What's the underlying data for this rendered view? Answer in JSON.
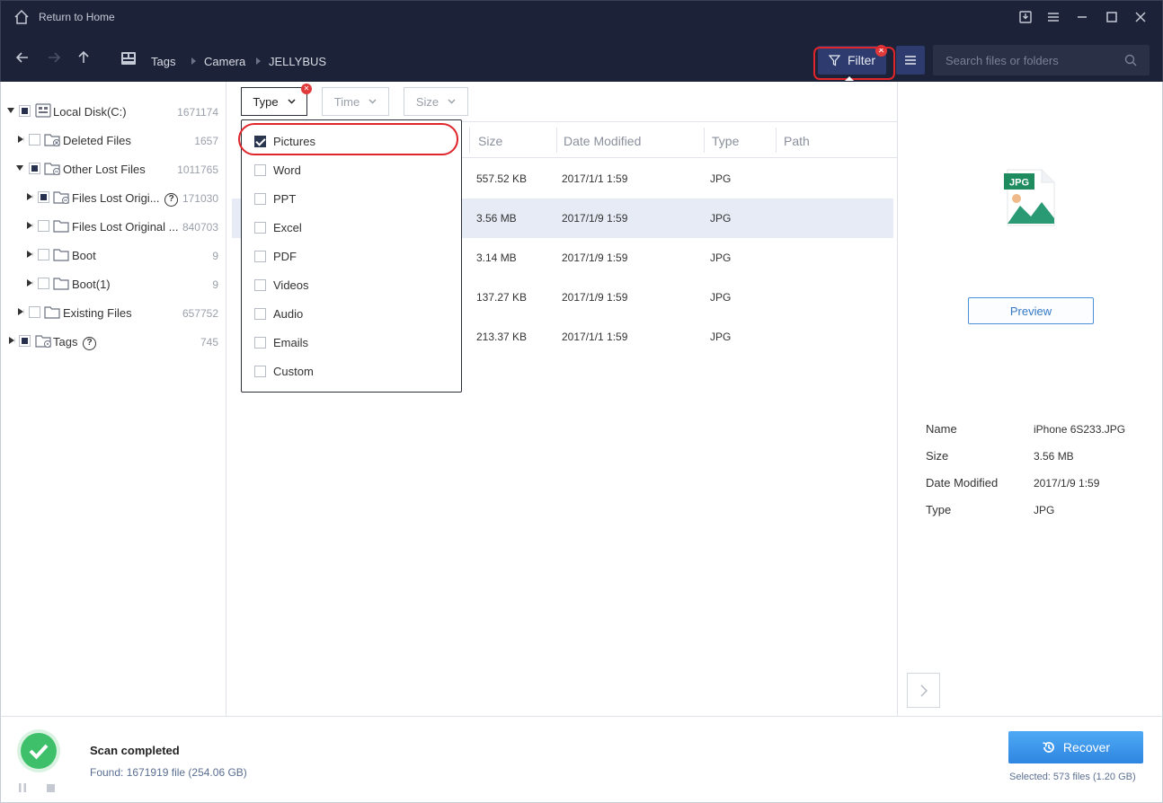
{
  "titlebar": {
    "home_label": "Return to Home"
  },
  "nav": {
    "breadcrumb": [
      "Tags",
      "Camera",
      "JELLYBUS"
    ],
    "filter_label": "Filter",
    "search_placeholder": "Search files or folders"
  },
  "tree": [
    {
      "label": "Local Disk(C:)",
      "count": "1671174"
    },
    {
      "label": "Deleted Files",
      "count": "1657"
    },
    {
      "label": "Other Lost Files",
      "count": "1011765"
    },
    {
      "label": "Files Lost Origi...",
      "count": "171030"
    },
    {
      "label": "Files Lost Original ...",
      "count": "840703"
    },
    {
      "label": "Boot",
      "count": "9"
    },
    {
      "label": "Boot(1)",
      "count": "9"
    },
    {
      "label": "Existing Files",
      "count": "657752"
    },
    {
      "label": "Tags",
      "count": "745"
    }
  ],
  "filters": {
    "type": "Type",
    "time": "Time",
    "size": "Size"
  },
  "type_options": [
    "Pictures",
    "Word",
    "PPT",
    "Excel",
    "PDF",
    "Videos",
    "Audio",
    "Emails",
    "Custom"
  ],
  "columns": {
    "size": "Size",
    "date": "Date Modified",
    "type": "Type",
    "path": "Path"
  },
  "files": [
    {
      "size": "557.52 KB",
      "date": "2017/1/1 1:59",
      "type": "JPG"
    },
    {
      "size": "3.56 MB",
      "date": "2017/1/9 1:59",
      "type": "JPG"
    },
    {
      "size": "3.14 MB",
      "date": "2017/1/9 1:59",
      "type": "JPG"
    },
    {
      "size": "137.27 KB",
      "date": "2017/1/9 1:59",
      "type": "JPG"
    },
    {
      "size": "213.37 KB",
      "date": "2017/1/1 1:59",
      "type": "JPG"
    }
  ],
  "preview": {
    "badge": "JPG",
    "button": "Preview",
    "props": [
      {
        "k": "Name",
        "v": "iPhone 6S233.JPG"
      },
      {
        "k": "Size",
        "v": "3.56 MB"
      },
      {
        "k": "Date Modified",
        "v": "2017/1/9 1:59"
      },
      {
        "k": "Type",
        "v": "JPG"
      }
    ]
  },
  "footer": {
    "status": "Scan completed",
    "found": "Found: 1671919 file (254.06 GB)",
    "recover": "Recover",
    "selected": "Selected: 573 files (1.20 GB)"
  },
  "colors": {
    "titlebar": "#1c2237",
    "accent": "#2e86e0",
    "highlight_ring": "#e0252b",
    "success": "#3ec06a"
  }
}
